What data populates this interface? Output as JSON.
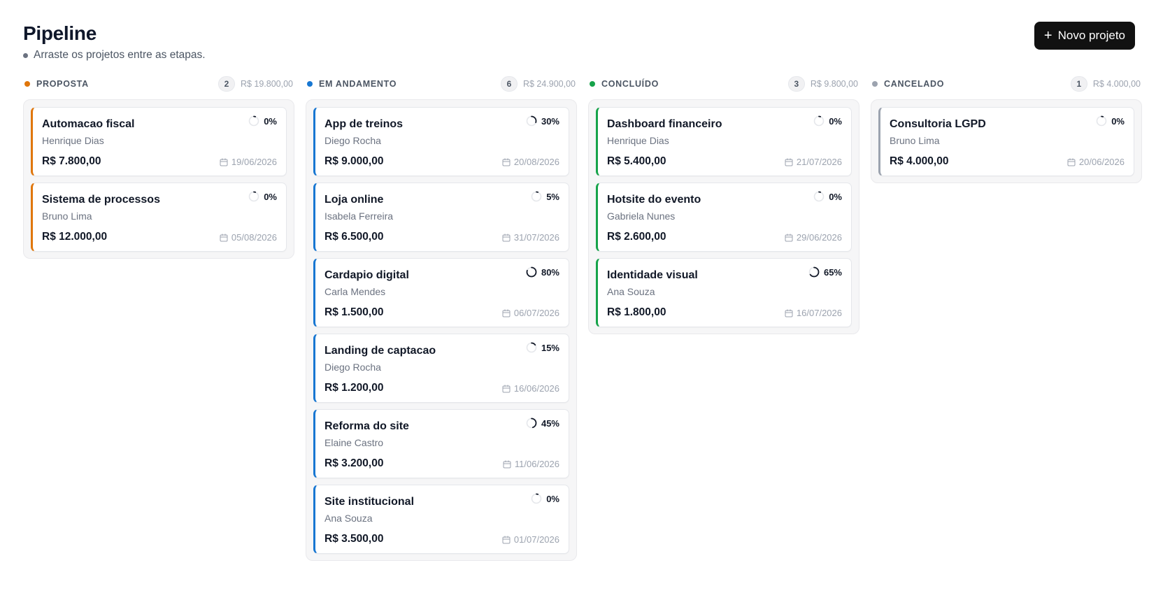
{
  "header": {
    "title": "Pipeline",
    "subtitle": "Arraste os projetos entre as etapas.",
    "new_button_icon": "plus-icon",
    "new_button_label": "Novo projeto"
  },
  "colors": {
    "proposta": "#e0760b",
    "andamento": "#1877d2",
    "concluido": "#16a34a",
    "cancelado": "#9ca3af",
    "button": "#111111"
  },
  "columns": [
    {
      "key": "proposta",
      "title": "PROPOSTA",
      "count": "2",
      "total": "R$ 19.800,00",
      "color": "#e0760b",
      "cards": [
        {
          "title": "Automacao fiscal",
          "owner": "Henrique Dias",
          "value": "R$ 7.800,00",
          "date": "19/06/2026",
          "progress": "0%",
          "progress_value": 0
        },
        {
          "title": "Sistema de processos",
          "owner": "Bruno Lima",
          "value": "R$ 12.000,00",
          "date": "05/08/2026",
          "progress": "0%",
          "progress_value": 0
        }
      ]
    },
    {
      "key": "andamento",
      "title": "EM ANDAMENTO",
      "count": "6",
      "total": "R$ 24.900,00",
      "color": "#1877d2",
      "cards": [
        {
          "title": "App de treinos",
          "owner": "Diego Rocha",
          "value": "R$ 9.000,00",
          "date": "20/08/2026",
          "progress": "30%",
          "progress_value": 30
        },
        {
          "title": "Loja online",
          "owner": "Isabela Ferreira",
          "value": "R$ 6.500,00",
          "date": "31/07/2026",
          "progress": "5%",
          "progress_value": 5
        },
        {
          "title": "Cardapio digital",
          "owner": "Carla Mendes",
          "value": "R$ 1.500,00",
          "date": "06/07/2026",
          "progress": "80%",
          "progress_value": 80
        },
        {
          "title": "Landing de captacao",
          "owner": "Diego Rocha",
          "value": "R$ 1.200,00",
          "date": "16/06/2026",
          "progress": "15%",
          "progress_value": 15
        },
        {
          "title": "Reforma do site",
          "owner": "Elaine Castro",
          "value": "R$ 3.200,00",
          "date": "11/06/2026",
          "progress": "45%",
          "progress_value": 45
        },
        {
          "title": "Site institucional",
          "owner": "Ana Souza",
          "value": "R$ 3.500,00",
          "date": "01/07/2026",
          "progress": "0%",
          "progress_value": 0
        }
      ]
    },
    {
      "key": "concluido",
      "title": "CONCLUÍDO",
      "count": "3",
      "total": "R$ 9.800,00",
      "color": "#16a34a",
      "cards": [
        {
          "title": "Dashboard financeiro",
          "owner": "Henrique Dias",
          "value": "R$ 5.400,00",
          "date": "21/07/2026",
          "progress": "0%",
          "progress_value": 0
        },
        {
          "title": "Hotsite do evento",
          "owner": "Gabriela Nunes",
          "value": "R$ 2.600,00",
          "date": "29/06/2026",
          "progress": "0%",
          "progress_value": 0
        },
        {
          "title": "Identidade visual",
          "owner": "Ana Souza",
          "value": "R$ 1.800,00",
          "date": "16/07/2026",
          "progress": "65%",
          "progress_value": 65
        }
      ]
    },
    {
      "key": "cancelado",
      "title": "CANCELADO",
      "count": "1",
      "total": "R$ 4.000,00",
      "color": "#9ca3af",
      "cards": [
        {
          "title": "Consultoria LGPD",
          "owner": "Bruno Lima",
          "value": "R$ 4.000,00",
          "date": "20/06/2026",
          "progress": "0%",
          "progress_value": 0
        }
      ]
    }
  ]
}
